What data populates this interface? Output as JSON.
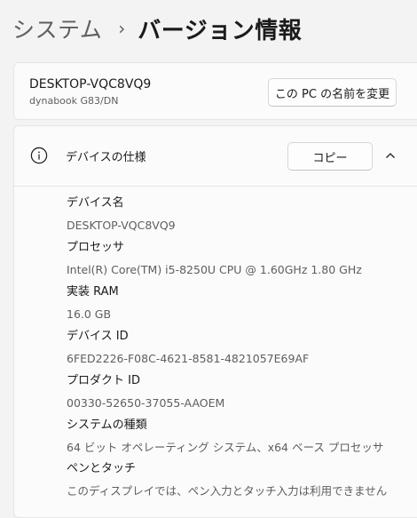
{
  "breadcrumb": {
    "parent": "システム",
    "separator": "›",
    "current": "バージョン情報"
  },
  "device": {
    "name": "DESKTOP-VQC8VQ9",
    "model": "dynabook G83/DN",
    "rename_button": "この PC の名前を変更"
  },
  "specs": {
    "title": "デバイスの仕様",
    "copy_button": "コピー",
    "items": [
      {
        "label": "デバイス名",
        "value": "DESKTOP-VQC8VQ9"
      },
      {
        "label": "プロセッサ",
        "value": "Intel(R) Core(TM) i5-8250U CPU @ 1.60GHz   1.80 GHz"
      },
      {
        "label": "実装 RAM",
        "value": "16.0 GB"
      },
      {
        "label": "デバイス ID",
        "value": "6FED2226-F08C-4621-8581-4821057E69AF"
      },
      {
        "label": "プロダクト ID",
        "value": "00330-52650-37055-AAOEM"
      },
      {
        "label": "システムの種類",
        "value": "64 ビット オペレーティング システム、x64 ベース プロセッサ"
      },
      {
        "label": "ペンとタッチ",
        "value": "このディスプレイでは、ペン入力とタッチ入力は利用できません"
      }
    ]
  },
  "icons": {
    "info": "info-icon",
    "chevron": "chevron-up-icon"
  }
}
